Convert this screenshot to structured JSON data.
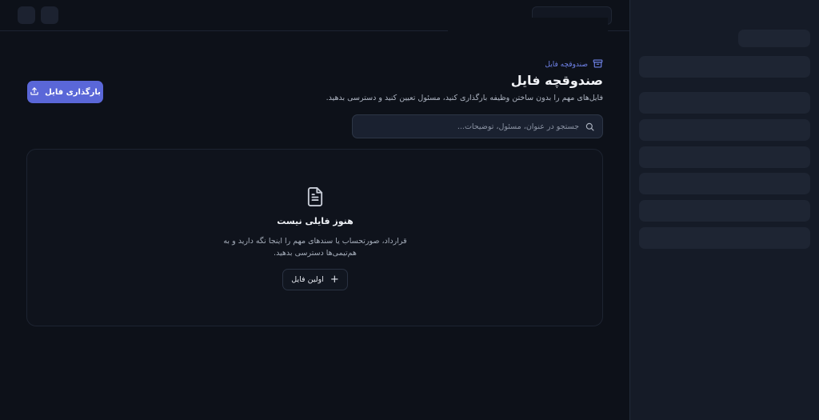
{
  "header": {
    "eyebrow": "صندوقچه فایل",
    "title": "صندوقچه فایل",
    "subtitle": "فایل‌های مهم را بدون ساختن وظیفه بارگذاری کنید، مسئول تعیین کنید و دسترسی بدهید.",
    "upload_label": "بارگذاری فایل"
  },
  "search": {
    "placeholder": "جستجو در عنوان، مسئول، توضیحات..."
  },
  "empty_state": {
    "title": "هنوز فایلی نیست",
    "description": "قرارداد، صورتحساب یا سندهای مهم را اینجا نگه دارید و به هم‌تیمی‌ها دسترسی بدهید.",
    "first_button": "اولین فایل"
  },
  "icons": {
    "eyebrow": "archive-icon",
    "upload": "upload-icon",
    "search": "search-icon",
    "empty": "document-icon",
    "add": "plus-icon"
  },
  "colors": {
    "accent": "#5a67d8",
    "background": "#0d1119",
    "sidebar": "#151b27"
  }
}
